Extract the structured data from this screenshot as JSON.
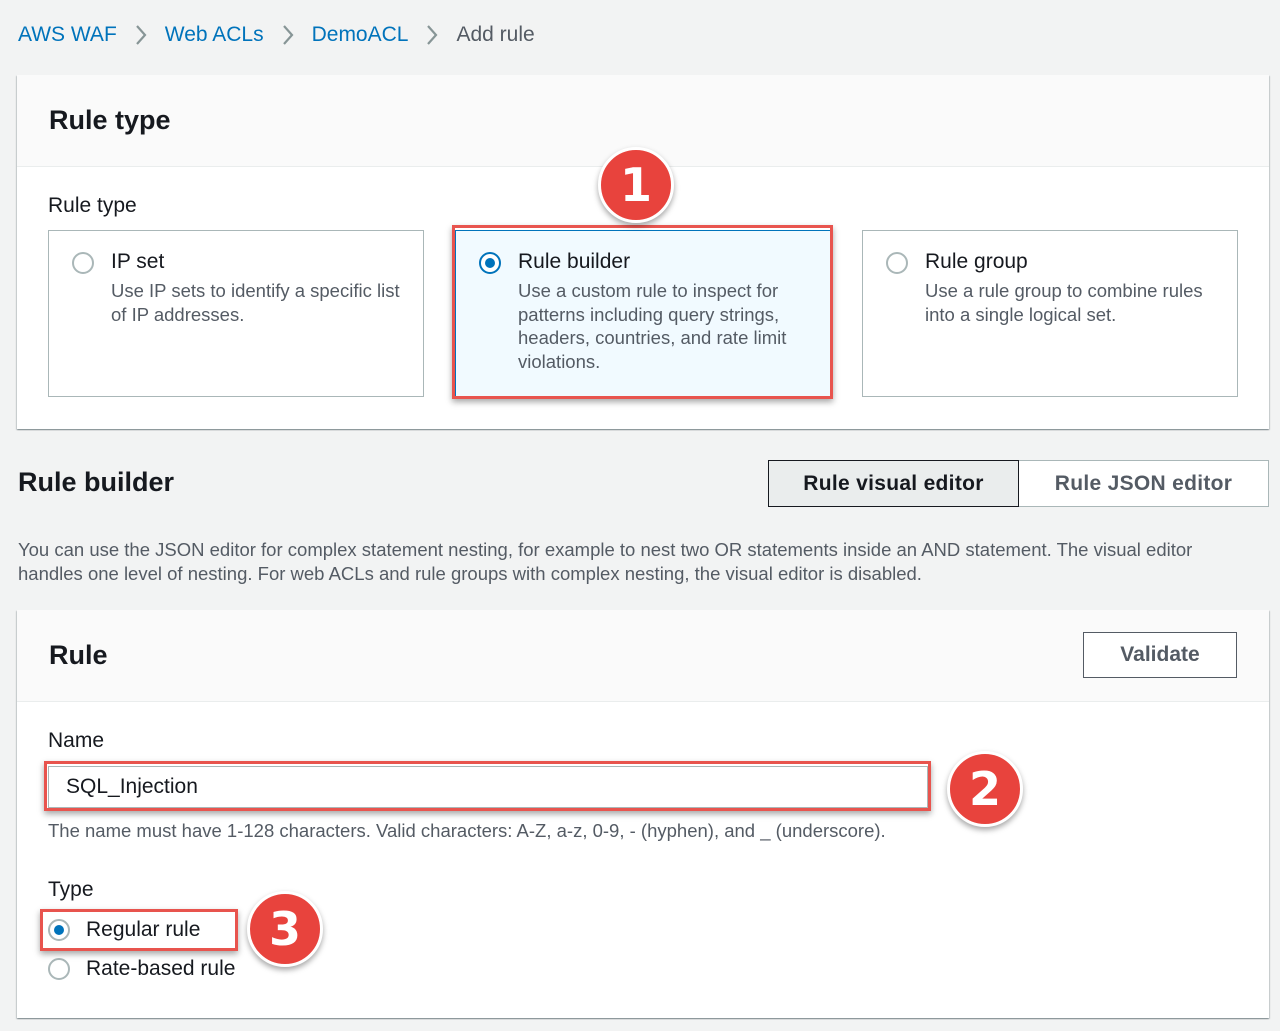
{
  "breadcrumb": {
    "items": [
      {
        "label": "AWS WAF"
      },
      {
        "label": "Web ACLs"
      },
      {
        "label": "DemoACL"
      },
      {
        "label": "Add rule"
      }
    ]
  },
  "rule_type_panel": {
    "title": "Rule type",
    "field_label": "Rule type",
    "options": [
      {
        "title": "IP set",
        "description": "Use IP sets to identify a specific list of IP addresses.",
        "selected": false
      },
      {
        "title": "Rule builder",
        "description": "Use a custom rule to inspect for patterns including query strings, headers, countries, and rate limit violations.",
        "selected": true
      },
      {
        "title": "Rule group",
        "description": "Use a rule group to combine rules into a single logical set.",
        "selected": false
      }
    ]
  },
  "rule_builder": {
    "title": "Rule builder",
    "editor_tabs": [
      {
        "label": "Rule visual editor",
        "active": true
      },
      {
        "label": "Rule JSON editor",
        "active": false
      }
    ],
    "description": "You can use the JSON editor for complex statement nesting, for example to nest two OR statements inside an AND statement. The visual editor handles one level of nesting. For web ACLs and rule groups with complex nesting, the visual editor is disabled."
  },
  "rule_panel": {
    "title": "Rule",
    "validate_label": "Validate",
    "name_label": "Name",
    "name_value": "SQL_Injection",
    "name_hint": "The name must have 1-128 characters. Valid characters: A-Z, a-z, 0-9, - (hyphen), and _ (underscore).",
    "type_label": "Type",
    "type_options": [
      {
        "label": "Regular rule",
        "selected": true
      },
      {
        "label": "Rate-based rule",
        "selected": false
      }
    ]
  },
  "annotations": {
    "step1": "1",
    "step2": "2",
    "step3": "3"
  },
  "colors": {
    "link": "#0073bb",
    "highlight": "#e8544e",
    "badge": "#e8433d"
  }
}
